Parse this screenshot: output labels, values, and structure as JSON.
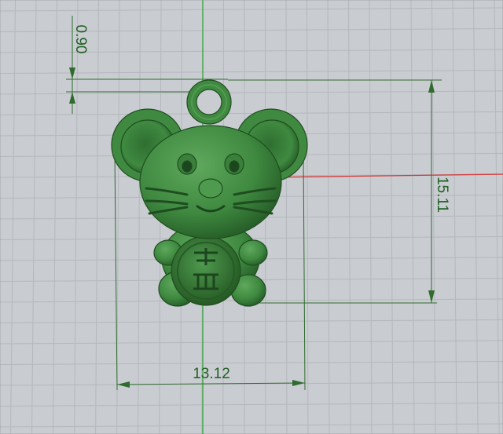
{
  "viewport": {
    "background": "#c9ccd0",
    "grid_minor_color": "#b4b8bd",
    "grid_major_color": "#a2a7ad",
    "axis_x_color": "#d23a3a",
    "axis_y_color": "#33a63a",
    "dimension_color": "#2f6b2f",
    "model_color": "#3e8a3e",
    "model_name": "rat-pendant"
  },
  "dimensions": {
    "loop_thickness": "0.90",
    "height": "15.11",
    "width": "13.12"
  }
}
